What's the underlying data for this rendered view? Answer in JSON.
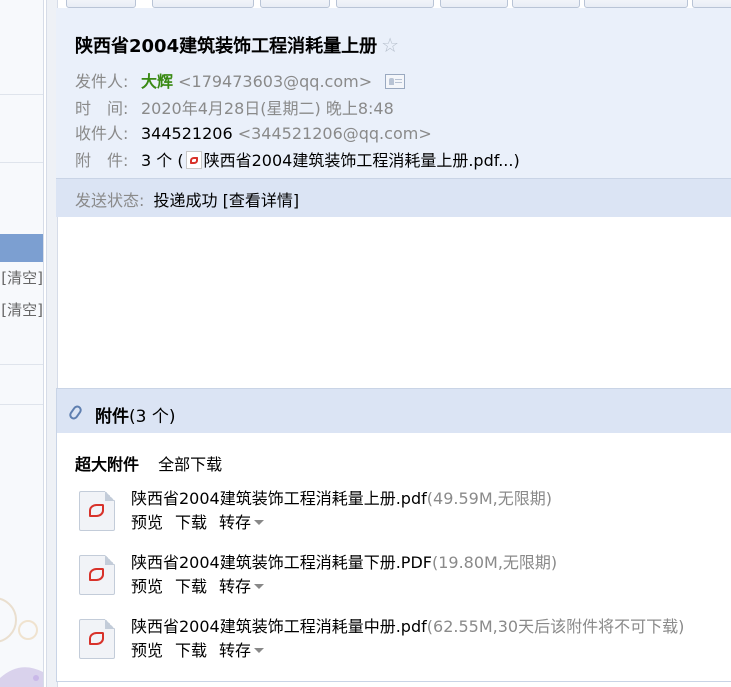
{
  "sidebar": {
    "clear_1": "[清空]",
    "clear_2": "[清空]"
  },
  "mail": {
    "subject": "陕西省2004建筑装饰工程消耗量上册",
    "from": {
      "label": "发件人:",
      "name": "大辉",
      "address": "<179473603@qq.com>"
    },
    "time": {
      "label": "时　间:",
      "value": "2020年4月28日(星期二) 晚上8:48"
    },
    "to": {
      "label": "收件人:",
      "name": "344521206",
      "address": "<344521206@qq.com>"
    },
    "attachments_summary": {
      "label": "附　件:",
      "count": "3 个",
      "open": "(",
      "first_file": "陕西省2004建筑装饰工程消耗量上册.pdf...",
      "close": ")"
    },
    "status": {
      "label": "发送状态:",
      "value": "投递成功",
      "details_link": "[查看详情]"
    }
  },
  "attachments": {
    "title": "附件",
    "count": "(3 个)",
    "tab_large": "超大附件",
    "download_all": "全部下载",
    "files": [
      {
        "name": "陕西省2004建筑装饰工程消耗量上册.pdf",
        "info": "(49.59M,无限期)",
        "preview": "预览",
        "download": "下载",
        "save": "转存"
      },
      {
        "name": "陕西省2004建筑装饰工程消耗量下册.PDF",
        "info": "(19.80M,无限期)",
        "preview": "预览",
        "download": "下载",
        "save": "转存"
      },
      {
        "name": "陕西省2004建筑装饰工程消耗量中册.pdf",
        "info": "(62.55M,30天后该附件将不可下载)",
        "preview": "预览",
        "download": "下载",
        "save": "转存"
      }
    ]
  },
  "colors": {
    "header_bg": "#eaf0fa",
    "status_bg": "#dbe4f4",
    "sender_name": "#3a8a14",
    "muted": "#8a8a8a",
    "pdf_red": "#d8322a"
  }
}
